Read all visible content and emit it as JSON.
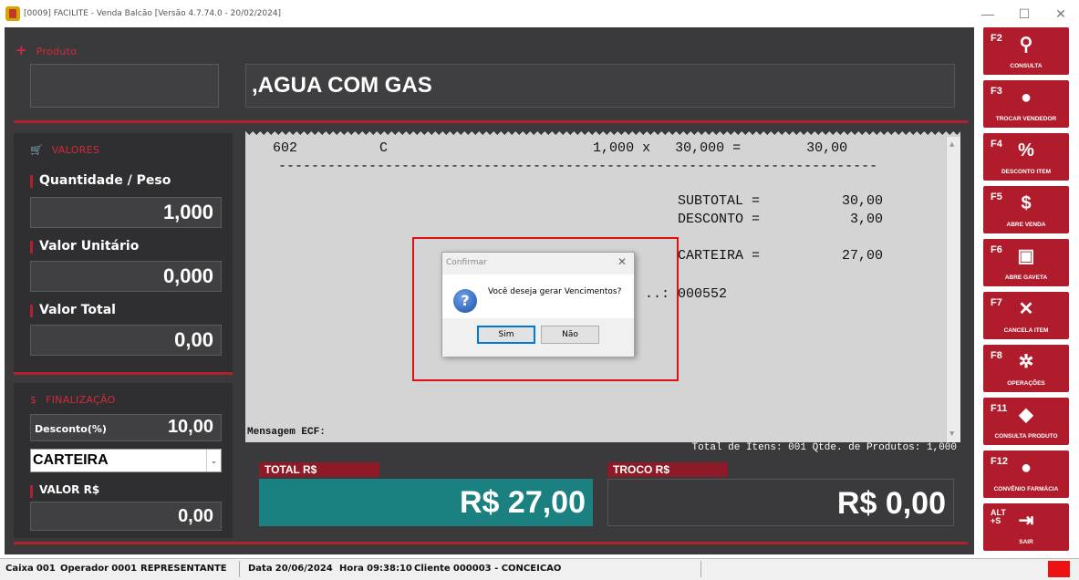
{
  "window": {
    "title": "[0009] FACILITE - Venda Balcão [Versão 4.7.74.0 - 20/02/2024]"
  },
  "produto": {
    "section_label": "Produto",
    "code": "",
    "name": ",AGUA COM GAS"
  },
  "valores": {
    "section_label": "VALORES",
    "quantidade_label": "Quantidade / Peso",
    "quantidade_value": "1,000",
    "valor_unitario_label": "Valor Unitário",
    "valor_unitario_value": "0,000",
    "valor_total_label": "Valor Total",
    "valor_total_value": "0,00"
  },
  "finalizacao": {
    "section_label": "FINALIZAÇÃO",
    "desconto_label": "Desconto(%)",
    "desconto_value": "10,00",
    "payment_selected": "CARTEIRA",
    "valor_label": "VALOR R$",
    "valor_value": "0,00"
  },
  "receipt": {
    "line1": "602          C                         1,000 x   30,000 =        30,00",
    "divider": "-------------------------------------------------------------------------",
    "subtotal": "SUBTOTAL =          30,00",
    "desconto": "DESCONTO =           3,00",
    "carteira": "CARTEIRA =          27,00",
    "doc": "..: 000552",
    "mensagem": "Mensagem ECF:"
  },
  "info": {
    "text": "Total de Itens: 001   Qtde. de Produtos: 1,000"
  },
  "totals": {
    "total_label": "TOTAL R$",
    "total_value": "R$ 27,00",
    "troco_label": "TROCO R$",
    "troco_value": "R$ 0,00"
  },
  "sidebar": {
    "buttons": [
      {
        "key": "F2",
        "label": "CONSULTA",
        "icon": "search-icon"
      },
      {
        "key": "F3",
        "label": "TROCAR VENDEDOR",
        "icon": "user-icon"
      },
      {
        "key": "F4",
        "label": "DESCONTO ITEM",
        "icon": "percent-icon"
      },
      {
        "key": "F5",
        "label": "ABRE VENDA",
        "icon": "dollar-icon"
      },
      {
        "key": "F6",
        "label": "ABRE GAVETA",
        "icon": "drawer-icon"
      },
      {
        "key": "F7",
        "label": "CANCELA ITEM",
        "icon": "close-icon"
      },
      {
        "key": "F8",
        "label": "OPERAÇÕES",
        "icon": "gear-icon"
      },
      {
        "key": "F11",
        "label": "CONSULTA PRODUTO",
        "icon": "tag-icon"
      },
      {
        "key": "F12",
        "label": "CONVÊNIO FARMÁCIA",
        "icon": "pills-icon"
      },
      {
        "key": "ALT\n+S",
        "label": "SAIR",
        "icon": "exit-icon"
      }
    ]
  },
  "dialog": {
    "title": "Confirmar",
    "message": "Você deseja gerar Vencimentos?",
    "yes": "Sim",
    "no": "Não"
  },
  "status": {
    "caixa_label": "Caixa",
    "caixa": "001",
    "operador_label": "Operador",
    "operador": "0001",
    "operador_nome": "REPRESENTANTE",
    "data_label": "Data",
    "data": "20/06/2024",
    "hora_label": "Hora",
    "hora": "09:38:10",
    "cliente_label": "Cliente",
    "cliente": "000003 - CONCEICAO"
  },
  "colors": {
    "accent_red": "#b01c2b",
    "total_teal": "#1a8080",
    "background_dark": "#3a3a3c"
  }
}
